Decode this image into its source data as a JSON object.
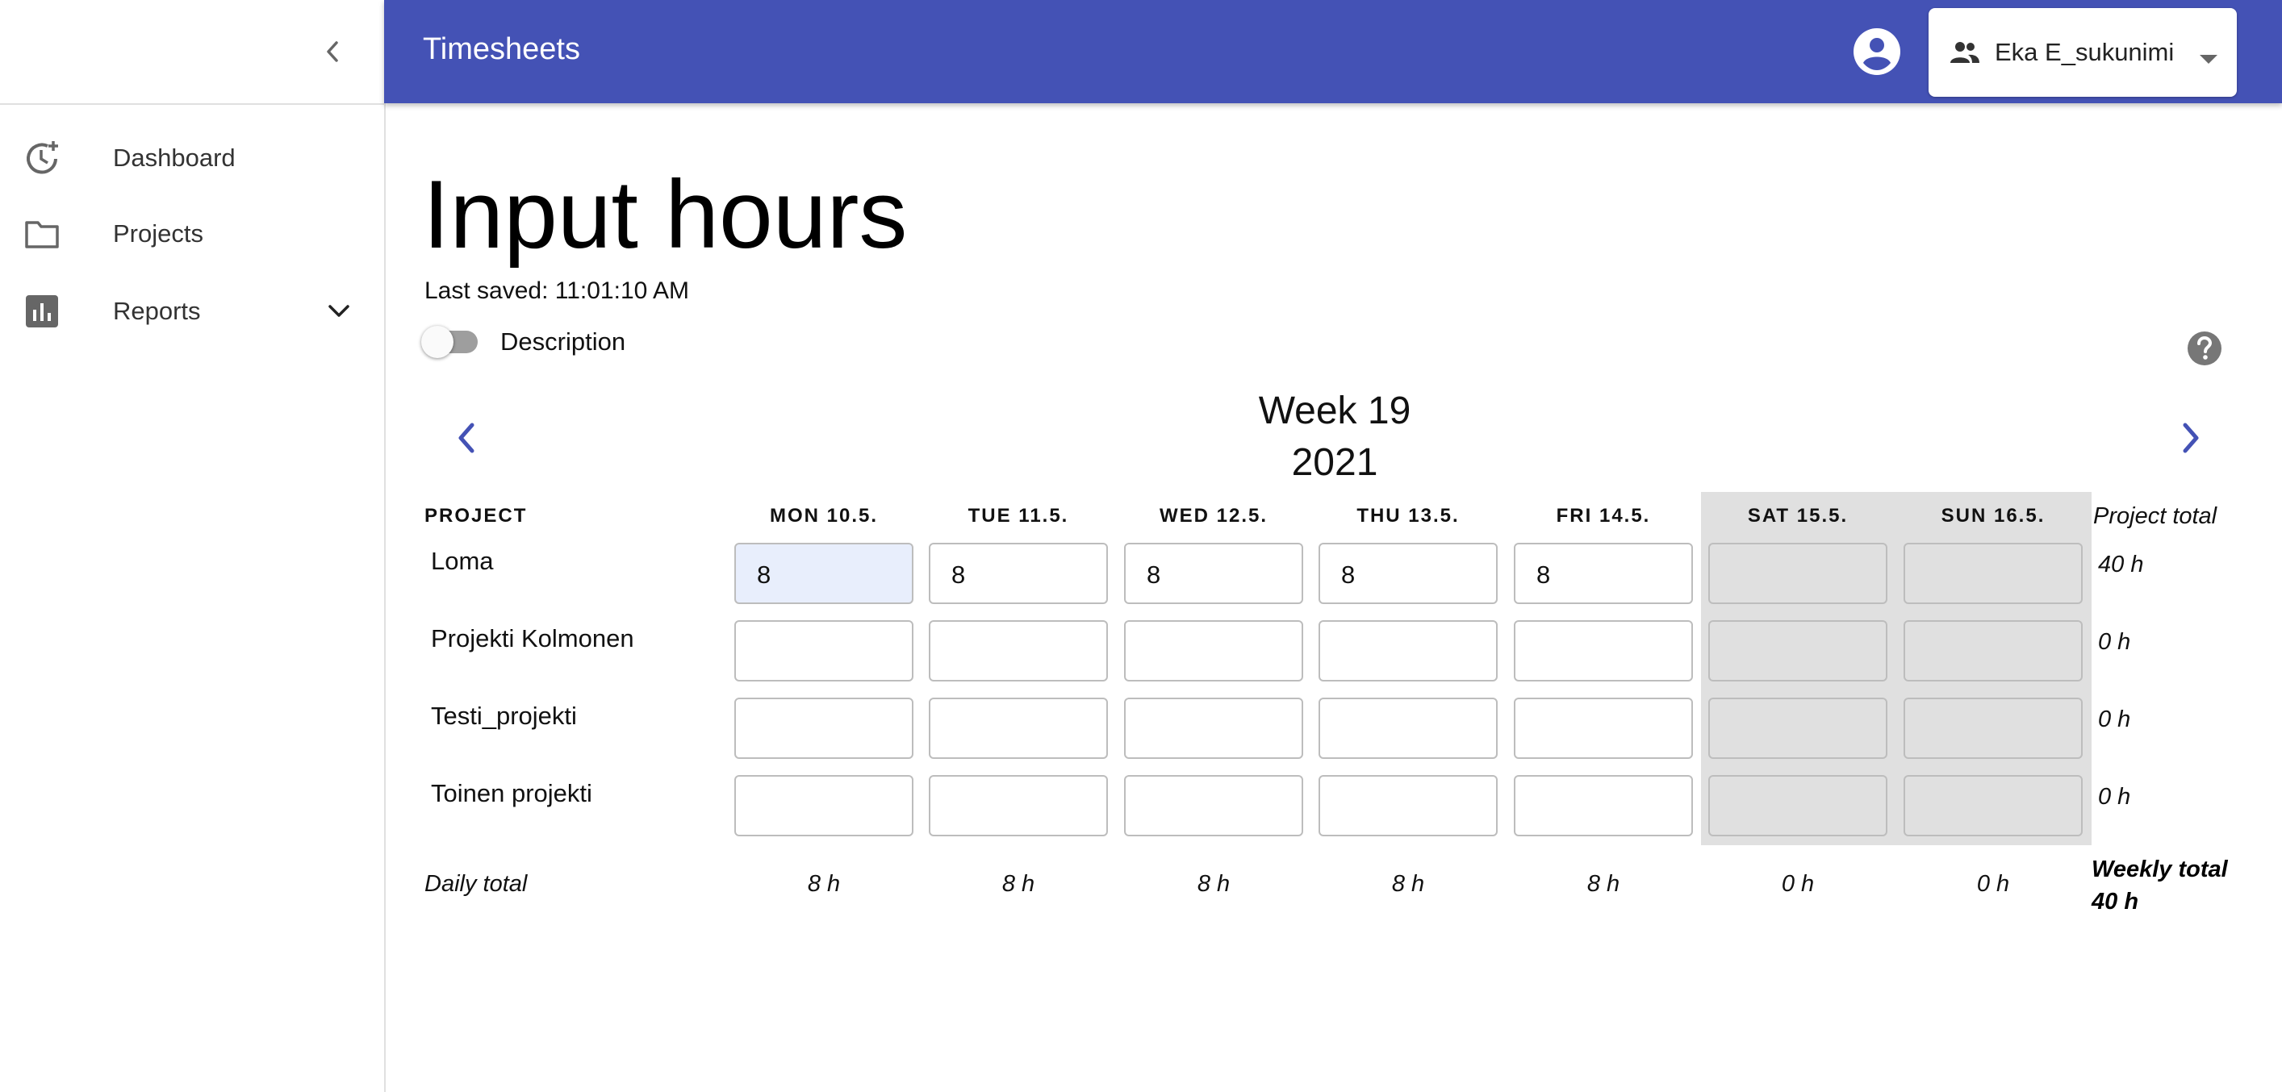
{
  "app": {
    "title": "Timesheets",
    "accent": "#4452b5"
  },
  "user": {
    "name": "Eka E_sukunimi"
  },
  "sidebar": {
    "items": [
      {
        "label": "Dashboard",
        "icon": "dashboard-icon"
      },
      {
        "label": "Projects",
        "icon": "folder-icon"
      },
      {
        "label": "Reports",
        "icon": "bar-chart-icon"
      }
    ]
  },
  "page": {
    "title": "Input hours",
    "last_saved": "Last saved: 11:01:10 AM",
    "description_toggle": {
      "label": "Description",
      "on": false
    }
  },
  "week": {
    "label": "Week 19",
    "year": "2021"
  },
  "table": {
    "project_header": "PROJECT",
    "total_header": "Project total",
    "days": [
      {
        "label": "MON 10.5.",
        "weekend": false
      },
      {
        "label": "TUE 11.5.",
        "weekend": false
      },
      {
        "label": "WED 12.5.",
        "weekend": false
      },
      {
        "label": "THU 13.5.",
        "weekend": false
      },
      {
        "label": "FRI 14.5.",
        "weekend": false
      },
      {
        "label": "SAT 15.5.",
        "weekend": true
      },
      {
        "label": "SUN 16.5.",
        "weekend": true
      }
    ],
    "rows": [
      {
        "project": "Loma",
        "hours": [
          "8",
          "8",
          "8",
          "8",
          "8",
          "",
          ""
        ],
        "total": "40 h"
      },
      {
        "project": "Projekti Kolmonen",
        "hours": [
          "",
          "",
          "",
          "",
          "",
          "",
          ""
        ],
        "total": "0 h"
      },
      {
        "project": "Testi_projekti",
        "hours": [
          "",
          "",
          "",
          "",
          "",
          "",
          ""
        ],
        "total": "0 h"
      },
      {
        "project": "Toinen projekti",
        "hours": [
          "",
          "",
          "",
          "",
          "",
          "",
          ""
        ],
        "total": "0 h"
      }
    ],
    "daily_total_label": "Daily total",
    "daily_totals": [
      "8 h",
      "8 h",
      "8 h",
      "8 h",
      "8 h",
      "0 h",
      "0 h"
    ],
    "weekly_total_label": "Weekly total",
    "weekly_total": "40 h"
  }
}
